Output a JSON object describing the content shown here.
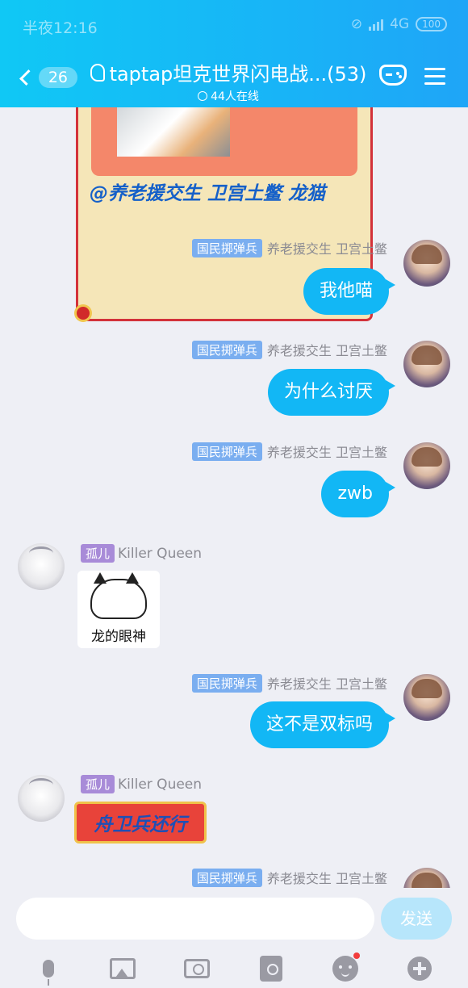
{
  "status_bar": {
    "time": "半夜12:16",
    "network": "4G",
    "battery": "100"
  },
  "header": {
    "back_count": "26",
    "title": "taptap坦克世界闪电战...(53)",
    "online": "44人在线"
  },
  "messages": [
    {
      "side": "right",
      "tag": "国民掷弹兵",
      "name": "养老援交生 卫宫土鳖",
      "text": "我他喵"
    },
    {
      "side": "right",
      "tag": "国民掷弹兵",
      "name": "养老援交生 卫宫土鳖",
      "text": "为什么讨厌"
    },
    {
      "side": "right",
      "tag": "国民掷弹兵",
      "name": "养老援交生 卫宫土鳖",
      "text": "zwb"
    },
    {
      "side": "left",
      "tag": "孤儿",
      "name": "Killer Queen",
      "sticker_text": "龙的眼神"
    },
    {
      "side": "right",
      "tag": "国民掷弹兵",
      "name": "养老援交生 卫宫土鳖",
      "text": "这不是双标吗"
    },
    {
      "side": "left",
      "tag": "孤儿",
      "name": "Killer Queen",
      "sticker_text": "舟卫兵还行"
    },
    {
      "side": "right",
      "tag": "国民掷弹兵",
      "name": "养老援交生 卫宫土鳖"
    }
  ],
  "top_sticker": {
    "caption": "@养老援交生 卫宫土鳖 龙猫"
  },
  "input": {
    "placeholder": "",
    "send_label": "发送"
  },
  "colors": {
    "header": "#12b7f5",
    "bubble": "#12b7f5",
    "tag_blue": "#7aaef0",
    "tag_purple": "#a88bd8"
  },
  "toolbar_icons": [
    "mic-icon",
    "image-icon",
    "camera-icon",
    "red-packet-icon",
    "emoji-icon",
    "plus-icon"
  ]
}
